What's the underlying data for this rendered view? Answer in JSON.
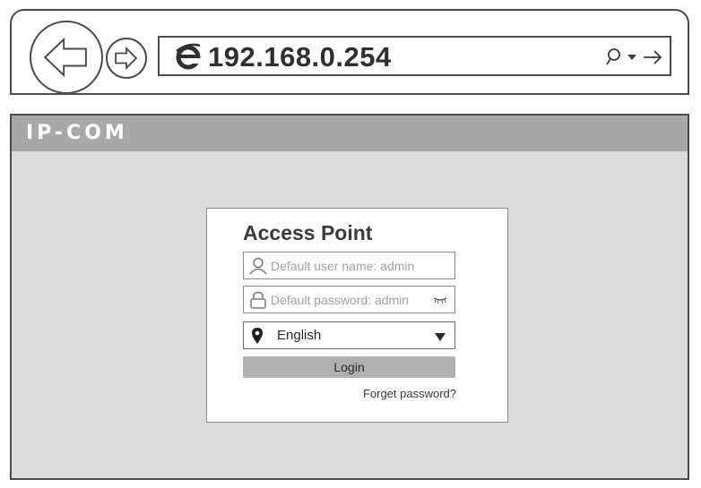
{
  "browser": {
    "url": "192.168.0.254",
    "icons": [
      "back-arrow-icon",
      "forward-arrow-icon",
      "ie-icon",
      "search-icon",
      "dropdown-arrow-icon",
      "go-arrow-icon"
    ]
  },
  "header": {
    "brand": "IP-COM"
  },
  "login": {
    "title": "Access Point",
    "username_placeholder": "Default user name: admin",
    "password_placeholder": "Default password: admin",
    "language": "English",
    "login_label": "Login",
    "forget_label": "Forget password?"
  },
  "colors": {
    "header_bg": "#a8a8a8",
    "page_bg": "#dcdcdc",
    "button_bg": "#b0b0b0"
  }
}
